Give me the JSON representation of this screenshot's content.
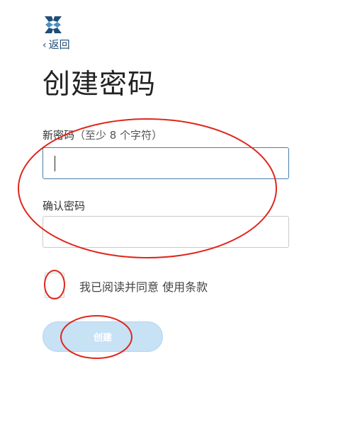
{
  "header": {
    "logo_icon": "brand-logo-icon",
    "back_label": "返回",
    "back_icon": "chevron-left-icon"
  },
  "page": {
    "title": "创建密码"
  },
  "form": {
    "new_password_label": "新密码",
    "new_password_hint": "（至少 8 个字符）",
    "new_password_value": "",
    "confirm_password_label": "确认密码",
    "confirm_password_value": "",
    "agree_text": "我已阅读并同意",
    "terms_link": "使用条款",
    "agree_checked": false,
    "create_button": "创建",
    "create_enabled": false
  },
  "colors": {
    "link": "#1f4e79",
    "button_bg_disabled": "#c7e1f5",
    "annotation": "#e0261b",
    "input_focus_border": "#4a7fa8"
  }
}
